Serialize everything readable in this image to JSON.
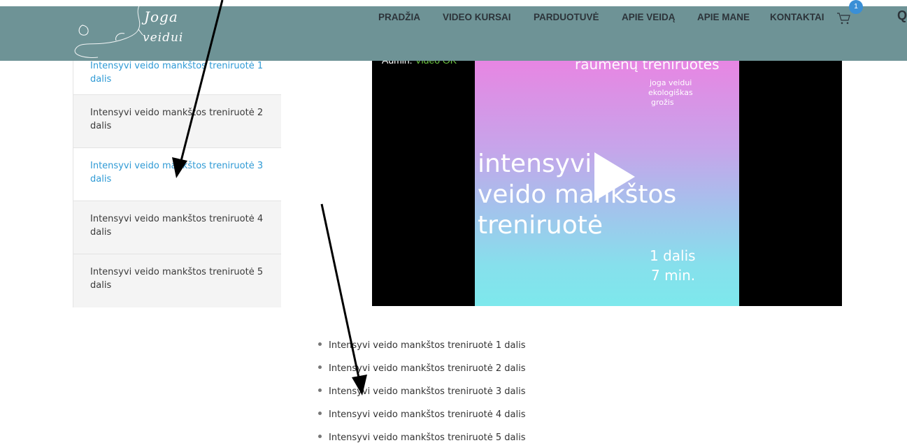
{
  "header": {
    "logo_text_1": "Joga",
    "logo_text_2": "veidui",
    "nav": [
      {
        "label": "PRADŽIA"
      },
      {
        "label": "VIDEO KURSAI"
      },
      {
        "label": "PARDUOTUVĖ"
      },
      {
        "label": "APIE VEIDĄ"
      },
      {
        "label": "APIE MANE"
      },
      {
        "label": "KONTAKTAI"
      }
    ],
    "cart_icon": "cart-icon",
    "cart_count": "1",
    "search_partial": "Q"
  },
  "sidebar": {
    "items": [
      {
        "label": "Intensyvi veido mankštos treniruotė 1 dalis"
      },
      {
        "label": "Intensyvi veido mankštos treniruotė 2 dalis"
      },
      {
        "label": "Intensyvi veido mankštos treniruotė 3 dalis"
      },
      {
        "label": "Intensyvi veido mankštos treniruotė 4 dalis"
      },
      {
        "label": "Intensyvi veido mankštos treniruotė 5 dalis"
      }
    ]
  },
  "video": {
    "admin_label": "Admin:",
    "admin_link": "Video OK",
    "poster": {
      "top_text": "raumenų treniruotės",
      "brand_1": "joga veidui",
      "brand_2": "ekologiškas",
      "brand_3": "grožis",
      "title_1": "intensyvi",
      "title_2": "veido mankštos",
      "title_3": "treniruotė",
      "part": "1 dalis",
      "duration": "7 min."
    },
    "play_icon": "play-icon"
  },
  "list": {
    "items": [
      {
        "label": "Intensyvi veido mankštos treniruotė 1 dalis"
      },
      {
        "label": "Intensyvi veido mankštos treniruotė 2 dalis"
      },
      {
        "label": "Intensyvi veido mankštos treniruotė 3 dalis"
      },
      {
        "label": "Intensyvi veido mankštos treniruotė 4 dalis"
      },
      {
        "label": "Intensyvi veido mankštos treniruotė 5 dalis"
      }
    ]
  },
  "colors": {
    "header_bg": "#6e9396",
    "active_link": "#2f9ad5",
    "admin_link": "#6cc641"
  }
}
